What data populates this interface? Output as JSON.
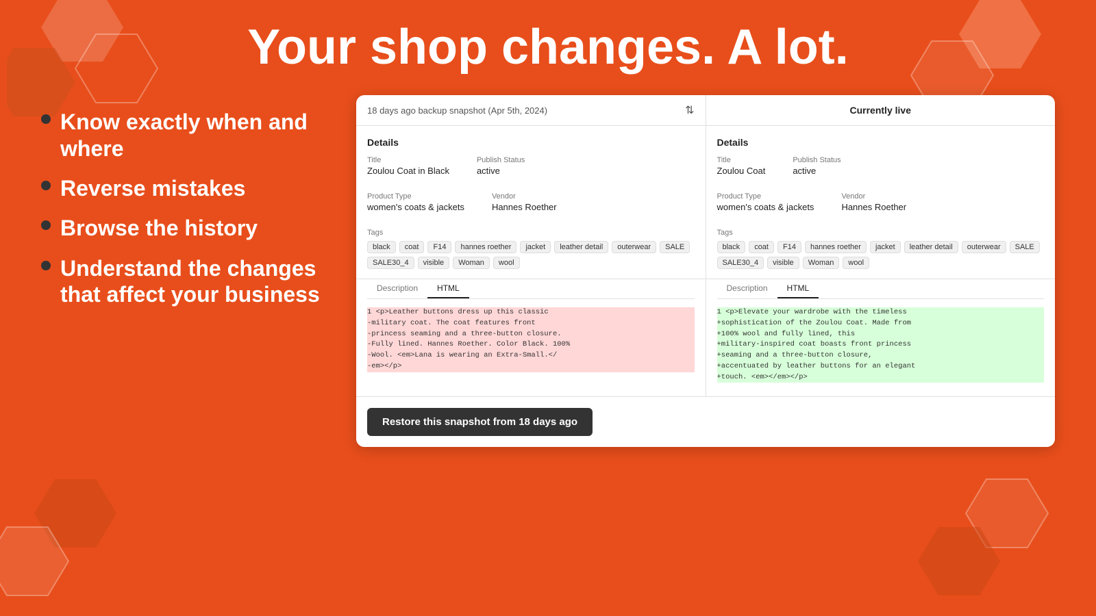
{
  "page": {
    "title": "Your shop changes. A lot.",
    "background_color": "#e84e1b"
  },
  "bullets": [
    {
      "id": "bullet-1",
      "text": "Know exactly when and where"
    },
    {
      "id": "bullet-2",
      "text": "Reverse mistakes"
    },
    {
      "id": "bullet-3",
      "text": "Browse the history"
    },
    {
      "id": "bullet-4",
      "text": "Understand the changes that affect your business"
    }
  ],
  "comparison": {
    "left_header": "18 days ago backup snapshot (Apr 5th, 2024)",
    "right_header": "Currently live",
    "left": {
      "section_title": "Details",
      "title_label": "Title",
      "title_value": "Zoulou Coat in Black",
      "publish_status_label": "Publish Status",
      "publish_status_value": "active",
      "product_type_label": "Product Type",
      "product_type_value": "women's coats & jackets",
      "vendor_label": "Vendor",
      "vendor_value": "Hannes Roether",
      "tags_label": "Tags",
      "tags": [
        "black",
        "coat",
        "F14",
        "hannes roether",
        "jacket",
        "leather detail",
        "outerwear",
        "SALE",
        "SALE30_4",
        "visible",
        "Woman",
        "wool"
      ],
      "desc_tab": "Description",
      "html_tab": "HTML",
      "active_tab": "HTML",
      "code_lines": [
        {
          "num": "1",
          "type": "removed",
          "text": "<p>Leather buttons dress up this classic"
        },
        {
          "num": "",
          "type": "removed",
          "text": "-military coat. The coat features front"
        },
        {
          "num": "",
          "type": "removed",
          "text": "-princess seaming and a three-button closure."
        },
        {
          "num": "",
          "type": "removed",
          "text": "-Fully lined. Hannes Roether. Color Black. 100%"
        },
        {
          "num": "",
          "type": "removed",
          "text": "-Wool. <em>Lana is wearing an Extra-Small.</"
        },
        {
          "num": "",
          "type": "removed",
          "text": "-em></p>"
        }
      ]
    },
    "right": {
      "section_title": "Details",
      "title_label": "Title",
      "title_value": "Zoulou Coat",
      "publish_status_label": "Publish Status",
      "publish_status_value": "active",
      "product_type_label": "Product Type",
      "product_type_value": "women's coats & jackets",
      "vendor_label": "Vendor",
      "vendor_value": "Hannes Roether",
      "tags_label": "Tags",
      "tags": [
        "black",
        "coat",
        "F14",
        "hannes roether",
        "jacket",
        "leather detail",
        "outerwear",
        "SALE",
        "SALE30_4",
        "visible",
        "Woman",
        "wool"
      ],
      "desc_tab": "Description",
      "html_tab": "HTML",
      "active_tab": "HTML",
      "code_lines": [
        {
          "num": "1",
          "type": "added",
          "text": "<p>Elevate your wardrobe with the timeless"
        },
        {
          "num": "",
          "type": "added",
          "text": "+sophistication of the Zoulou Coat. Made from"
        },
        {
          "num": "",
          "type": "added",
          "text": "+100% wool and fully lined, this"
        },
        {
          "num": "",
          "type": "added",
          "text": "+military-inspired coat boasts front princess"
        },
        {
          "num": "",
          "type": "added",
          "text": "+seaming and a three-button closure,"
        },
        {
          "num": "",
          "type": "added",
          "text": "+accentuated by leather buttons for an elegant"
        },
        {
          "num": "",
          "type": "added",
          "text": "+touch. <em></em></p>"
        }
      ]
    },
    "restore_button_label": "Restore this snapshot from 18 days ago"
  }
}
